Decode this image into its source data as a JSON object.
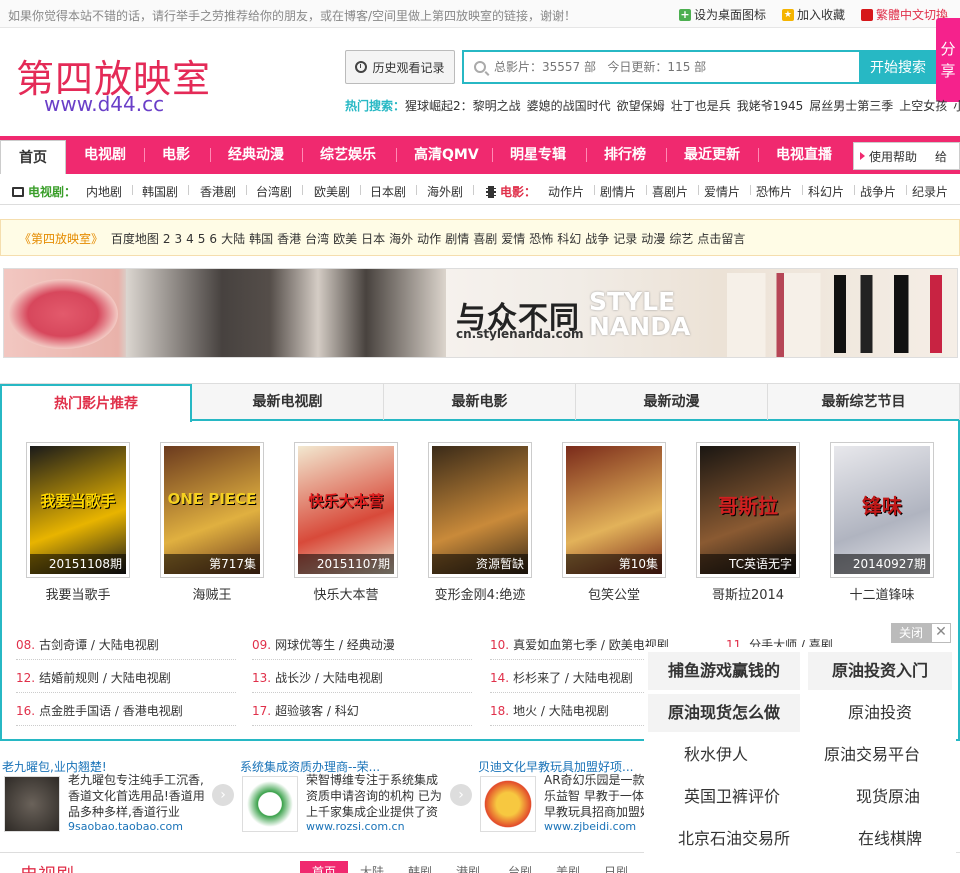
{
  "topbar": {
    "notice": "如果你觉得本站不错的话，请行举手之劳推荐给你的朋友，或在博客/空间里做上第四放映室的链接，谢谢！",
    "set_desktop": "设为桌面图标",
    "add_favorite": "加入收藏",
    "lang_switch": "繁體中文切換"
  },
  "header": {
    "logo": "第四放映室",
    "url": "www.d44.cc",
    "history_label": "历史观看记录",
    "search_placeholder": "总影片：35557 部   今日更新：115 部",
    "search_button": "开始搜索",
    "share": "分享",
    "hot_label": "热门搜索：",
    "hot_keywords": [
      "猩球崛起2：黎明之战",
      "婆媳的战国时代",
      "欲望保姆",
      "壮丁也是兵",
      "我姥爷1945",
      "屌丝男士第三季",
      "上空女孩",
      "小"
    ]
  },
  "nav": {
    "items": [
      "首页",
      "电视剧",
      "电影",
      "经典动漫",
      "综艺娱乐",
      "高清QMV",
      "明星专辑",
      "排行榜",
      "最近更新",
      "电视直播"
    ],
    "help": "使用帮助",
    "help_more": "给"
  },
  "subnav": {
    "tv_title": "电视剧：",
    "tv": [
      "内地剧",
      "韩国剧",
      "香港剧",
      "台湾剧",
      "欧美剧",
      "日本剧",
      "海外剧"
    ],
    "movie_title": "电影：",
    "movie": [
      "动作片",
      "剧情片",
      "喜剧片",
      "爱情片",
      "恐怖片",
      "科幻片",
      "战争片",
      "纪录片"
    ]
  },
  "quickbar": {
    "title": "《第四放映室》",
    "links": [
      "百度地图",
      "2",
      "3",
      "4",
      "5",
      "6",
      "大陆",
      "韩国",
      "香港",
      "台湾",
      "欧美",
      "日本",
      "海外",
      "动作",
      "剧情",
      "喜剧",
      "爱情",
      "恐怖",
      "科幻",
      "战争",
      "记录",
      "动漫",
      "综艺",
      "点击留言"
    ]
  },
  "banner": {
    "slogan": "与众不同",
    "url": "cn.stylenanda.com",
    "brand_line1": "STYLE",
    "brand_line2": "NANDA"
  },
  "tabs": [
    "热门影片推荐",
    "最新电视剧",
    "最新电影",
    "最新动漫",
    "最新综艺节目"
  ],
  "posters": [
    {
      "title": "我要当歌手",
      "caption": "20151108期",
      "bg1": "#1a1a1a",
      "bg2": "#e8b400",
      "mark": "我要当歌手",
      "mark_color": "#ffd800"
    },
    {
      "title": "海贼王",
      "caption": "第717集",
      "bg1": "#6b3a1e",
      "bg2": "#e0b040",
      "mark": "ONE PIECE",
      "mark_color": "#f5d020"
    },
    {
      "title": "快乐大本营",
      "caption": "20151107期",
      "bg1": "#f2e8d0",
      "bg2": "#d84a3a",
      "mark": "快乐大本营",
      "mark_color": "#e02020"
    },
    {
      "title": "变形金刚4:绝迹",
      "caption": "资源暂缺",
      "bg1": "#3a2a18",
      "bg2": "#c98a3a",
      "mark": "",
      "mark_color": "#f0c070"
    },
    {
      "title": "包笑公堂",
      "caption": "第10集",
      "bg1": "#7a2a1a",
      "bg2": "#e2b25a",
      "mark": "",
      "mark_color": "#ffd27a"
    },
    {
      "title": "哥斯拉2014",
      "caption": "TC英语无字",
      "bg1": "#1a1612",
      "bg2": "#8a5a32",
      "mark": "哥斯拉",
      "mark_color": "#d02020"
    },
    {
      "title": "十二道锋味",
      "caption": "20140927期",
      "bg1": "#e8e8ec",
      "bg2": "#b0b4c0",
      "mark": "锋味",
      "mark_color": "#c01818"
    }
  ],
  "ranks": [
    {
      "num": "08.",
      "text": "古剑奇谭 / 大陆电视剧"
    },
    {
      "num": "09.",
      "text": "网球优等生 / 经典动漫"
    },
    {
      "num": "10.",
      "text": "真爱如血第七季 / 欧美电视剧"
    },
    {
      "num": "11.",
      "text": "分手大师 / 喜剧"
    },
    {
      "num": "12.",
      "text": "结婚前规则 / 大陆电视剧"
    },
    {
      "num": "13.",
      "text": "战长沙 / 大陆电视剧"
    },
    {
      "num": "14.",
      "text": "杉杉来了 / 大陆电视剧"
    },
    {
      "num": "16.",
      "text": "点金胜手国语 / 香港电视剧"
    },
    {
      "num": "17.",
      "text": "超验骇客 / 科幻"
    },
    {
      "num": "18.",
      "text": "地火 / 大陆电视剧"
    }
  ],
  "ads": [
    {
      "title": "老九曜包,业内翘楚!",
      "text": "老九曜包专注纯手工沉香,香道文化首选用品!香道用品多种多样,香道行业",
      "url": "9saobao.taobao.com"
    },
    {
      "title": "系统集成资质办理商--荣...",
      "text": "荣智博维专注于系统集成资质申请咨询的机构 已为上千家集成企业提供了资",
      "url": "www.rozsi.com.cn"
    },
    {
      "title": "贝迪文化早教玩具加盟好项...",
      "text": "AR奇幻乐园是一款寓教于乐益智 早教于一体的AR早教玩具招商加盟好项",
      "url": "www.zjbeidi.com"
    }
  ],
  "section2": {
    "title": "电视剧",
    "tabs": [
      "首页",
      "大陆",
      "韩剧",
      "港剧",
      "台剧",
      "美剧",
      "日剧"
    ]
  },
  "popup": {
    "close": "关闭",
    "items": [
      "捕鱼游戏赢钱的",
      "原油投资入门",
      "原油现货怎么做",
      "原油投资",
      "秋水伊人",
      "原油交易平台",
      "英国卫裤评价",
      "现货原油",
      "北京石油交易所",
      "在线棋牌"
    ]
  }
}
